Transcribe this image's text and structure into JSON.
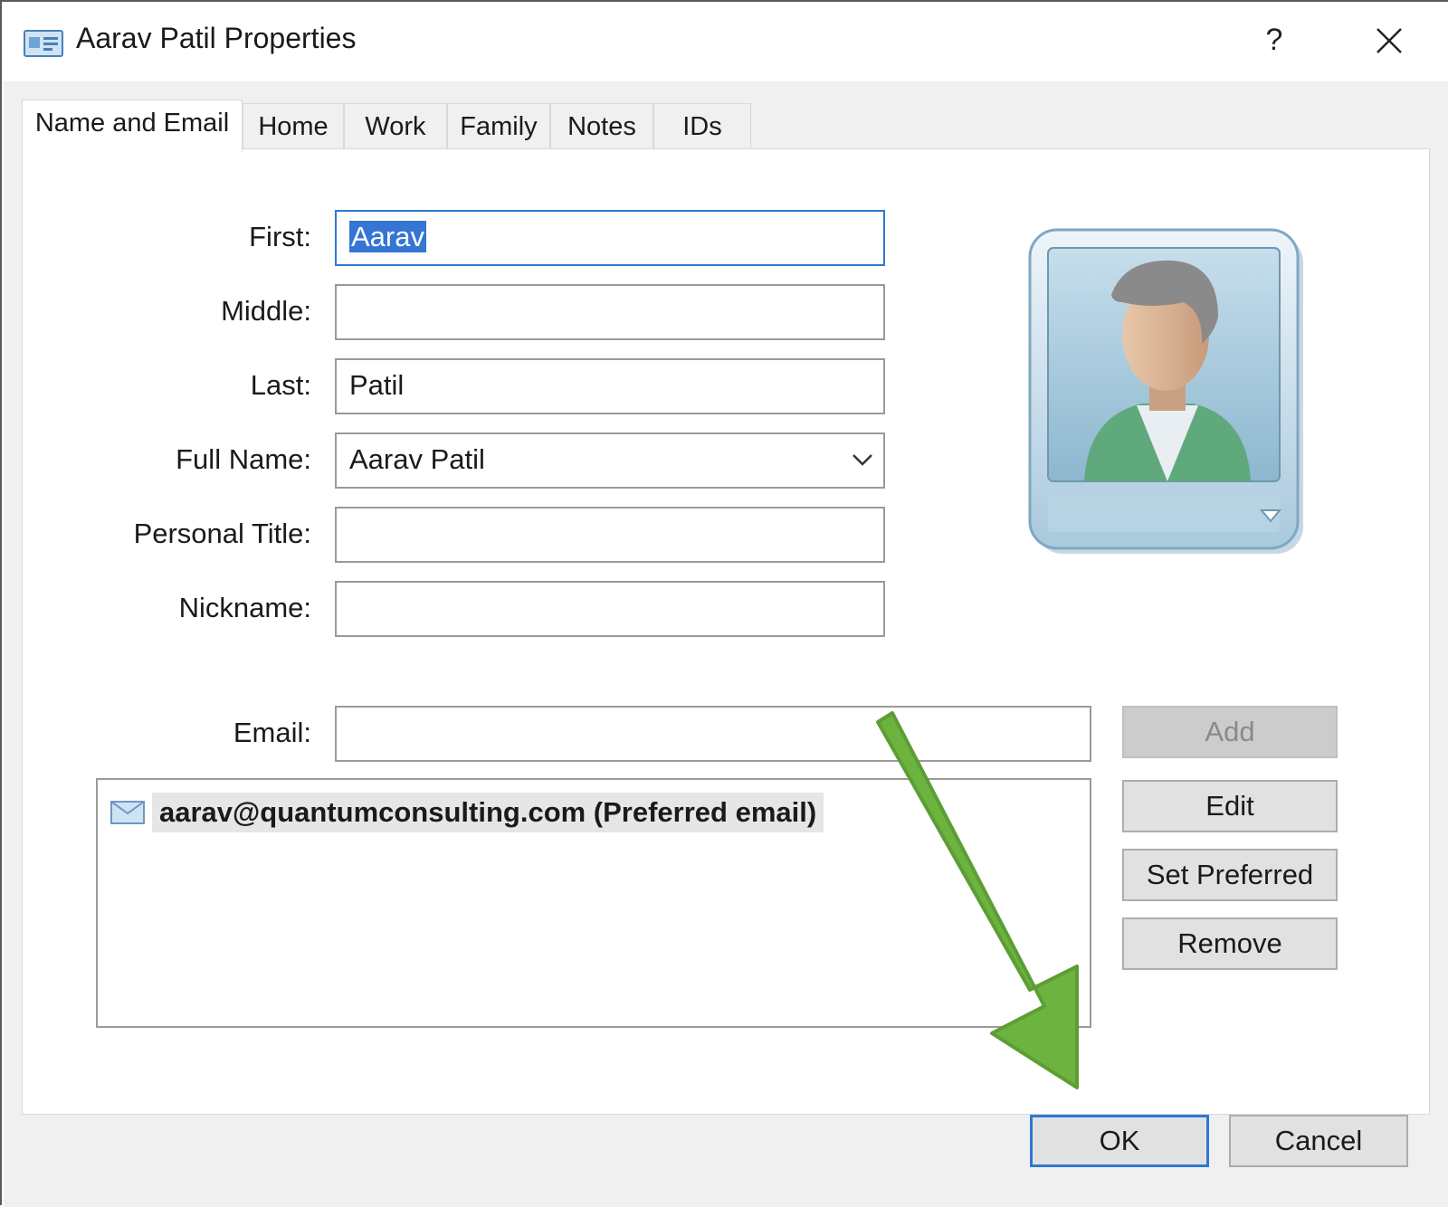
{
  "window": {
    "title": "Aarav Patil Properties",
    "help_label": "?"
  },
  "tabs": [
    {
      "label": "Name and Email",
      "active": true
    },
    {
      "label": "Home",
      "active": false
    },
    {
      "label": "Work",
      "active": false
    },
    {
      "label": "Family",
      "active": false
    },
    {
      "label": "Notes",
      "active": false
    },
    {
      "label": "IDs",
      "active": false
    }
  ],
  "form": {
    "first_label": "First:",
    "first_value": "Aarav",
    "middle_label": "Middle:",
    "middle_value": "",
    "last_label": "Last:",
    "last_value": "Patil",
    "fullname_label": "Full Name:",
    "fullname_value": "Aarav Patil",
    "title_label": "Personal Title:",
    "title_value": "",
    "nickname_label": "Nickname:",
    "nickname_value": "",
    "email_label": "Email:",
    "email_value": ""
  },
  "email_list": [
    {
      "text": "aarav@quantumconsulting.com  (Preferred email)"
    }
  ],
  "email_buttons": {
    "add": "Add",
    "edit": "Edit",
    "set_preferred": "Set Preferred",
    "remove": "Remove"
  },
  "footer": {
    "ok": "OK",
    "cancel": "Cancel"
  },
  "colors": {
    "accent": "#2f78d4",
    "annotation_arrow": "#6db33f"
  },
  "icons": [
    "contact-card-icon",
    "help-icon",
    "close-icon",
    "chevron-down-icon",
    "contact-avatar-icon",
    "envelope-icon",
    "annotation-arrow"
  ]
}
